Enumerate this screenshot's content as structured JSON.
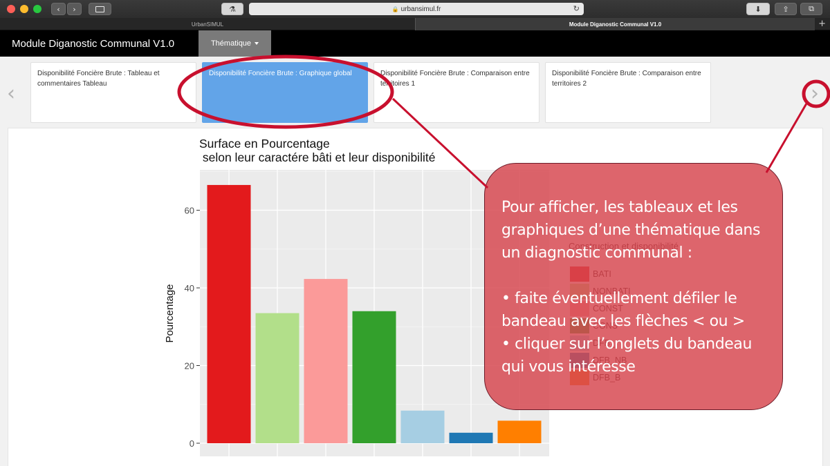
{
  "browser": {
    "url": "urbansimul.fr",
    "tabs": [
      {
        "label": "UrbanSIMUL",
        "active": false
      },
      {
        "label": "Module Diganostic Communal V1.0",
        "active": true
      }
    ]
  },
  "navbar": {
    "brand": "Module Diganostic Communal V1.0",
    "dropdown_label": "Thématique"
  },
  "carousel": {
    "prev_arrow": "‹",
    "next_arrow": "›",
    "cards": [
      {
        "label": "Disponibilité Foncière Brute : Tableau et commentaires Tableau",
        "active": false
      },
      {
        "label": "Disponibilité Foncière Brute : Graphique global",
        "active": true
      },
      {
        "label": "Disponibilité Foncière Brute : Comparaison entre territoires 1",
        "active": false
      },
      {
        "label": "Disponibilité Foncière Brute : Comparaison entre territoires 2",
        "active": false
      }
    ]
  },
  "chart_data": {
    "type": "bar",
    "title": "Surface en Pourcentage\n selon leur caractére bâti et leur disponibilité",
    "xlabel": "",
    "ylabel": "Pourcentage",
    "ylim": [
      0,
      70
    ],
    "yticks": [
      0,
      20,
      40,
      60
    ],
    "grid": true,
    "legend_title": "Construction et disponibilité",
    "categories": [
      "BATI",
      "NONBATI",
      "CONST",
      "CONS_DFB",
      "DFB_",
      "DFB_NB",
      "DFB_B"
    ],
    "values": [
      66.5,
      33.5,
      42.3,
      34.0,
      8.4,
      2.7,
      5.8
    ],
    "colors": [
      "#e31a1c",
      "#b2df8a",
      "#fb9a99",
      "#33a02c",
      "#a6cee3",
      "#1f78b4",
      "#ff7f00"
    ],
    "legend": [
      {
        "label": "BATI",
        "color": "#e31a1c"
      },
      {
        "label": "NONBATI",
        "color": "#b2df8a"
      },
      {
        "label": "CONST",
        "color": "#fb9a99"
      },
      {
        "label": "CONS",
        "color": "#33a02c"
      },
      {
        "label": "DFB_",
        "color": "#a6cee3"
      },
      {
        "label": "DFB_NB",
        "color": "#1f78b4"
      },
      {
        "label": "DFB_B",
        "color": "#ff7f00"
      }
    ]
  },
  "callout": {
    "intro": "Pour afficher, les tableaux et les graphiques d’une thématique dans un diagnostic communal :",
    "bullets": [
      "• faite éventuellement défiler le bandeau avec les flèches < ou >",
      "• cliquer sur l’onglets du bandeau qui vous intéresse"
    ]
  },
  "colors": {
    "annotation": "#c8102e",
    "active_card": "#62a4e8",
    "callout_fill": "#d64850"
  }
}
